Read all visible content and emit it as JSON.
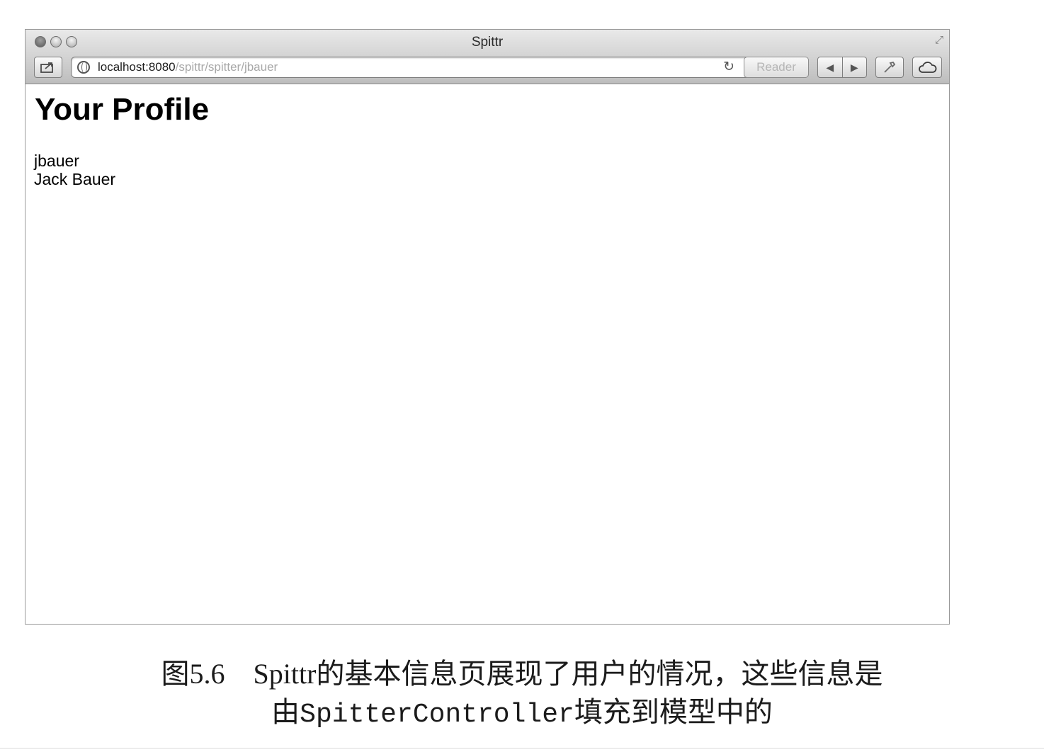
{
  "window": {
    "title": "Spittr",
    "address": {
      "host": "localhost:8080",
      "path": "/spittr/spitter/jbauer"
    },
    "reader_label": "Reader",
    "icons": {
      "share": "share-icon",
      "globe": "globe-icon",
      "reload": "reload-icon",
      "back": "back-arrow-icon",
      "forward": "forward-arrow-icon",
      "tools": "wrench-icon",
      "icloud": "cloud-icon",
      "fullscreen": "fullscreen-icon"
    }
  },
  "page": {
    "heading": "Your Profile",
    "username": "jbauer",
    "full_name": "Jack Bauer"
  },
  "caption": {
    "figure_number": "图5.6",
    "line1": "Spittr的基本信息页展现了用户的情况，这些信息是",
    "line2_prefix": "由",
    "line2_code": "SpitterController",
    "line2_suffix": "填充到模型中的"
  }
}
